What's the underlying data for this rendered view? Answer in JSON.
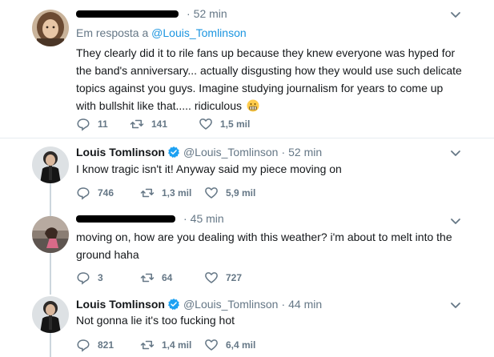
{
  "tweets": [
    {
      "author_name": "",
      "handle": "",
      "separator": "·",
      "time": "52 min",
      "reply_prefix": "Em resposta a",
      "reply_handle": "@Louis_Tomlinson",
      "text": "They clearly did it to rile fans up because they knew everyone was hyped for the band's anniversary... actually disgusting how they would use such delicate topics against you guys. Imagine studying journalism for years to come up with bullshit like that..... ridiculous",
      "emoji": "grimacing-face-emoji",
      "replies": "11",
      "retweets": "141",
      "likes": "1,5 mil"
    },
    {
      "author_name": "Louis Tomlinson",
      "handle": "@Louis_Tomlinson",
      "separator": "·",
      "time": "52 min",
      "text": "I know tragic isn't it! Anyway said my piece moving on",
      "replies": "746",
      "retweets": "1,3 mil",
      "likes": "5,9 mil"
    },
    {
      "author_name": "",
      "handle": "",
      "separator": "·",
      "time": "45 min",
      "text": "moving on, how are you dealing with this weather? i'm about to melt into the ground haha",
      "replies": "3",
      "retweets": "64",
      "likes": "727"
    },
    {
      "author_name": "Louis Tomlinson",
      "handle": "@Louis_Tomlinson",
      "separator": "·",
      "time": "44 min",
      "text": "Not gonna lie it's too fucking hot",
      "replies": "821",
      "retweets": "1,4 mil",
      "likes": "6,4 mil"
    }
  ],
  "icons": {
    "reply": "reply-icon",
    "retweet": "retweet-icon",
    "like": "heart-icon",
    "more": "chevron-down-icon",
    "verified": "verified-badge-icon"
  },
  "colors": {
    "link": "#1b95e0",
    "muted": "#657786",
    "text": "#14171a",
    "verified": "#1da1f2",
    "divider": "#e6ecf0",
    "thread_line": "#ccd6dd"
  }
}
